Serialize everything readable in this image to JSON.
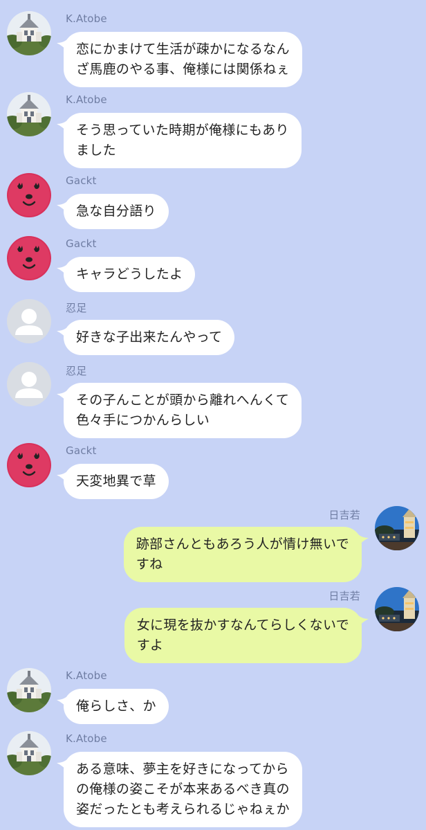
{
  "theme": {
    "background": "#c7d3f6",
    "incoming_bubble": "#ffffff",
    "outgoing_bubble": "#e9f9a5",
    "sender_color": "#6f7da3"
  },
  "messages": [
    {
      "side": "left",
      "avatar": "castle",
      "sender": "K.Atobe",
      "text": "恋にかまけて生活が疎かになるなん\nざ馬鹿のやる事、俺様には関係ねぇ"
    },
    {
      "side": "left",
      "avatar": "castle",
      "sender": "K.Atobe",
      "text": "そう思っていた時期が俺様にもあり\nました"
    },
    {
      "side": "left",
      "avatar": "pink-mascot",
      "sender": "Gackt",
      "text": "急な自分語り"
    },
    {
      "side": "left",
      "avatar": "pink-mascot",
      "sender": "Gackt",
      "text": "キャラどうしたよ"
    },
    {
      "side": "left",
      "avatar": "default-user",
      "sender": "忍足",
      "text": "好きな子出来たんやって"
    },
    {
      "side": "left",
      "avatar": "default-user",
      "sender": "忍足",
      "text": "その子んことが頭から離れへんくて\n色々手につかんらしい"
    },
    {
      "side": "left",
      "avatar": "pink-mascot",
      "sender": "Gackt",
      "text": "天変地異で草"
    },
    {
      "side": "right",
      "avatar": "night-tower",
      "sender": "日吉若",
      "text": "跡部さんともあろう人が情け無いで\nすね"
    },
    {
      "side": "right",
      "avatar": "night-tower",
      "sender": "日吉若",
      "text": "女に現を抜かすなんてらしくないで\nすよ"
    },
    {
      "side": "left",
      "avatar": "castle",
      "sender": "K.Atobe",
      "text": "俺らしさ、か"
    },
    {
      "side": "left",
      "avatar": "castle",
      "sender": "K.Atobe",
      "text": "ある意味、夢主を好きになってから\nの俺様の姿こそが本来あるべき真の\n姿だったとも考えられるじゃねぇか"
    }
  ]
}
